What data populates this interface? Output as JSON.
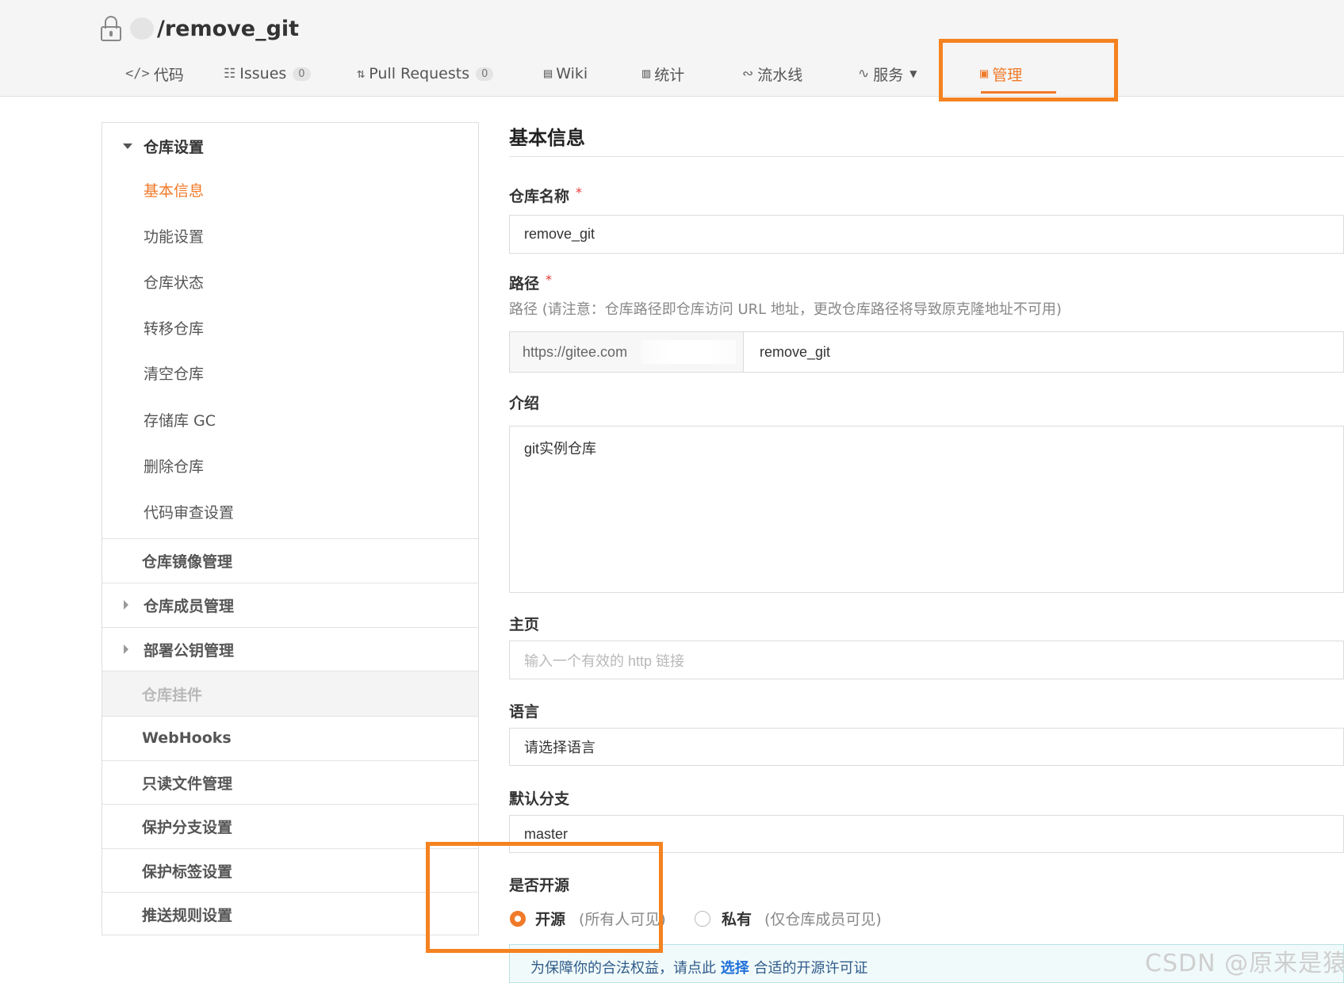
{
  "header": {
    "repo_name": "/remove_git"
  },
  "tabs": [
    {
      "label": "代码",
      "icon": "code-icon",
      "glyph": "</>"
    },
    {
      "label": "Issues",
      "icon": "issues-icon",
      "glyph": "☷",
      "count": "0"
    },
    {
      "label": "Pull Requests",
      "icon": "pull-request-icon",
      "glyph": "⇅",
      "count": "0"
    },
    {
      "label": "Wiki",
      "icon": "wiki-icon",
      "glyph": "▤"
    },
    {
      "label": "统计",
      "icon": "stats-icon",
      "glyph": "▥"
    },
    {
      "label": "流水线",
      "icon": "pipeline-icon",
      "glyph": "∾"
    },
    {
      "label": "服务",
      "icon": "service-icon",
      "glyph": "∿"
    },
    {
      "label": "管理",
      "icon": "manage-icon",
      "glyph": "▣"
    }
  ],
  "sidebar": {
    "group_title": "仓库设置",
    "items": [
      "基本信息",
      "功能设置",
      "仓库状态",
      "转移仓库",
      "清空仓库",
      "存储库 GC",
      "删除仓库",
      "代码审查设置"
    ],
    "sections": [
      "仓库镜像管理",
      "仓库成员管理",
      "部署公钥管理",
      "仓库挂件",
      "WebHooks",
      "只读文件管理",
      "保护分支设置",
      "保护标签设置",
      "推送规则设置"
    ]
  },
  "form": {
    "title": "基本信息",
    "name_label": "仓库名称",
    "name_value": "remove_git",
    "required_mark": "*",
    "path_label": "路径",
    "path_hint": "路径 (请注意：仓库路径即仓库访问 URL 地址，更改仓库路径将导致原克隆地址不可用)",
    "path_prefix": "https://gitee.com",
    "path_value": "remove_git",
    "intro_label": "介绍",
    "intro_value": "git实例仓库",
    "homepage_label": "主页",
    "homepage_placeholder": "输入一个有效的 http 链接",
    "language_label": "语言",
    "language_value": "请选择语言",
    "branch_label": "默认分支",
    "branch_value": "master",
    "open_source_label": "是否开源",
    "open_label": "开源",
    "open_note": "(所有人可见)",
    "private_label": "私有",
    "private_note": "(仅仓库成员可见)",
    "license_notice_prefix": "为保障你的合法权益，请点此",
    "license_notice_link": "选择",
    "license_notice_suffix": "合适的开源许可证"
  },
  "watermark": "CSDN @原来是猿",
  "colors": {
    "accent": "#f07a29",
    "highlight_box": "#f58220"
  }
}
